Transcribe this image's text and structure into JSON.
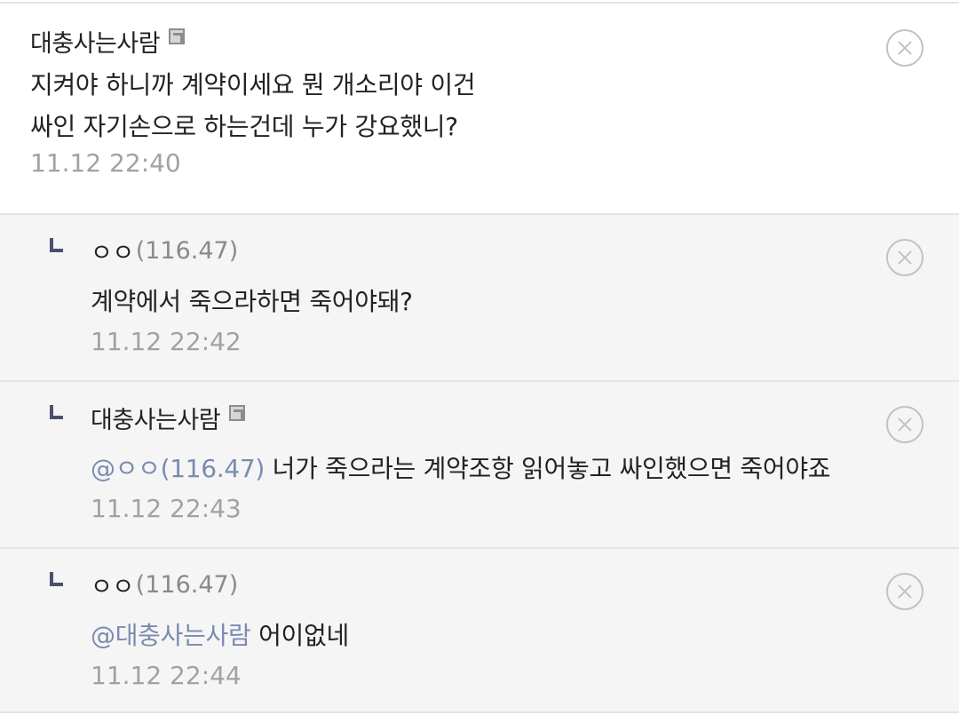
{
  "comments": [
    {
      "author": "대충사는사람",
      "ip": "",
      "lines": [
        "지켜야 하니까 계약이세요 뭔 개소리야 이건",
        "싸인 자기손으로 하는건데 누가 강요했니?"
      ],
      "time": "11.12 22:40"
    },
    {
      "author": "ㅇㅇ",
      "ip": "(116.47)",
      "text": "계약에서 죽으라하면 죽어야돼?",
      "time": "11.12 22:42"
    },
    {
      "author": "대충사는사람",
      "ip": "",
      "mention": "@ㅇㅇ(116.47)",
      "text": "너가 죽으라는 계약조항 읽어놓고 싸인했으면 죽어야죠",
      "time": "11.12 22:43"
    },
    {
      "author": "ㅇㅇ",
      "ip": "(116.47)",
      "mention": "@대충사는사람",
      "text": "어이없네",
      "time": "11.12 22:44"
    }
  ],
  "icons": {
    "gallog": "gallog-icon",
    "reply": "reply-arrow-icon",
    "delete": "delete-circle-x-icon"
  },
  "colors": {
    "mention": "#7b8bb0",
    "timestamp": "#a2a2a2",
    "reply_background": "#f5f5f5",
    "reply_mark": "#4b4f6e"
  }
}
